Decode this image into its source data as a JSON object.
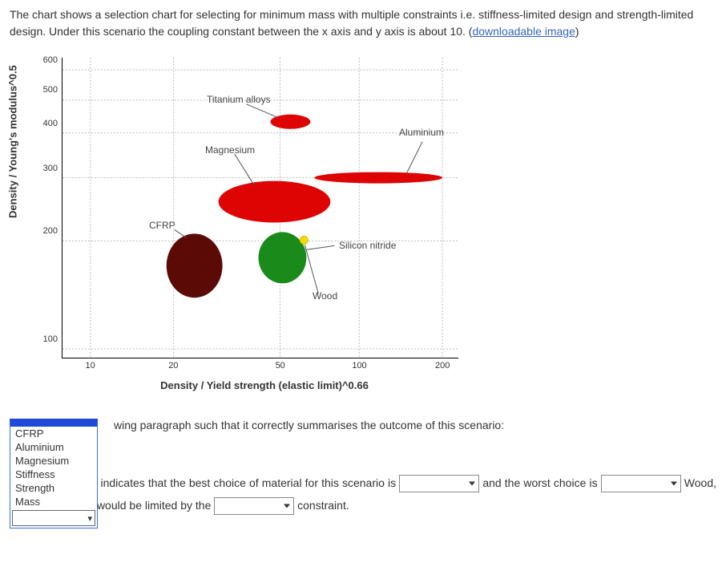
{
  "intro": {
    "text_a": "The chart shows a selection chart for selecting for minimum mass with multiple constraints i.e. stiffness-limited design and strength-limited design. Under this scenario the coupling constant between the x axis and y axis is about 10. (",
    "link": "downloadable image",
    "text_b": ")"
  },
  "axes": {
    "ylabel": "Density / Young's modulus^0.5",
    "xlabel": "Density / Yield strength (elastic limit)^0.66",
    "yticks": [
      "100",
      "200",
      "300",
      "400",
      "500",
      "600"
    ],
    "xticks": [
      "10",
      "20",
      "50",
      "100",
      "200"
    ]
  },
  "labels": {
    "titanium": "Titanium alloys",
    "magnesium": "Magnesium",
    "aluminium": "Aluminium",
    "cfrp": "CFRP",
    "silicon": "Silicon nitride",
    "wood": "Wood"
  },
  "dropdown": {
    "options": [
      "CFRP",
      "Aluminium",
      "Magnesium",
      "Stiffness",
      "Strength",
      "Mass"
    ]
  },
  "prompt": {
    "instr_suffix": "wing paragraph such that it correctly summarises the outcome of this scenario:",
    "para_a": "and box selection indicates that the best choice of material for this scenario is ",
    "para_b": " and the worst choice is ",
    "para_c": " Wood, if it were chosen, would be limited by the ",
    "para_d": " constraint."
  },
  "chart_data": {
    "type": "scatter",
    "title": "",
    "xlabel": "Density / Yield strength (elastic limit)^0.66",
    "ylabel": "Density / Young's modulus^0.5",
    "xscale": "log",
    "yscale": "log",
    "xlim": [
      8,
      250
    ],
    "ylim": [
      90,
      650
    ],
    "series": [
      {
        "name": "Titanium alloys",
        "x": 55,
        "y": 420,
        "color": "#de0404"
      },
      {
        "name": "Magnesium",
        "x": 50,
        "y": 260,
        "color": "#de0404"
      },
      {
        "name": "Aluminium",
        "x": 140,
        "y": 300,
        "color": "#de0404"
      },
      {
        "name": "CFRP",
        "x": 22,
        "y": 160,
        "color": "#5b0a05"
      },
      {
        "name": "Silicon nitride",
        "x": 60,
        "y": 175,
        "color": "#1a8a1a"
      },
      {
        "name": "Wood",
        "x": 70,
        "y": 180,
        "color": "#f6d90b"
      }
    ]
  }
}
